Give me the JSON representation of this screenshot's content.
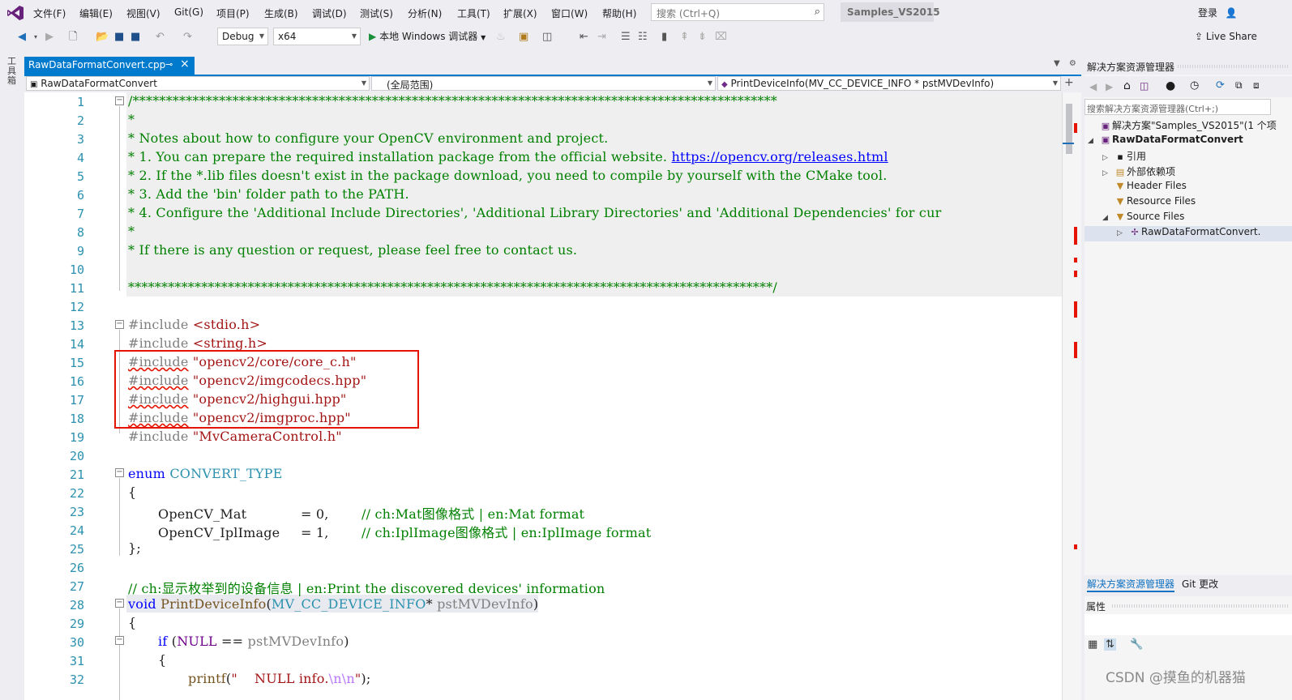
{
  "menu": {
    "items": [
      "文件(F)",
      "编辑(E)",
      "视图(V)",
      "Git(G)",
      "项目(P)",
      "生成(B)",
      "调试(D)",
      "测试(S)",
      "分析(N)",
      "工具(T)",
      "扩展(X)",
      "窗口(W)",
      "帮助(H)"
    ],
    "search_placeholder": "搜索 (Ctrl+Q)",
    "solution_name": "Samples_VS2015",
    "login": "登录"
  },
  "toolbar": {
    "config": "Debug",
    "platform": "x64",
    "run_label": "本地 Windows 调试器",
    "live_share": "Live Share"
  },
  "left_strip": {
    "label": "工具箱"
  },
  "editor": {
    "tab_title": "RawDataFormatConvert.cpp",
    "nav_project": "RawDataFormatConvert",
    "nav_scope": "(全局范围)",
    "nav_member": "PrintDeviceInfo(MV_CC_DEVICE_INFO * pstMVDevInfo)",
    "line_numbers": [
      "1",
      "2",
      "3",
      "4",
      "5",
      "6",
      "7",
      "8",
      "9",
      "10",
      "11",
      "12",
      "13",
      "14",
      "15",
      "16",
      "17",
      "18",
      "19",
      "20",
      "21",
      "22",
      "23",
      "24",
      "25",
      "26",
      "27",
      "28",
      "29",
      "30",
      "31",
      "32"
    ],
    "code": {
      "l1": "/*************************************************************************************************",
      "l2": "*",
      "l3": "* Notes about how to configure your OpenCV environment and project.",
      "l4_pre": "* 1. You can prepare the required installation package from the official website. ",
      "l4_url": "https://opencv.org/releases.html",
      "l5": "* 2. If the *.lib files doesn't exist in the package download, you need to compile by yourself with the CMake tool.",
      "l6": "* 3. Add the 'bin' folder path to the PATH.",
      "l7": "* 4. Configure the 'Additional Include Directories', 'Additional Library Directories' and 'Additional Dependencies' for cur",
      "l8": "*",
      "l9": "* If there is any question or request, please feel free to contact us.",
      "l11": "*************************************************************************************************/",
      "inc_kw": "#include",
      "l13_file": "<stdio.h>",
      "l14_file": "<string.h>",
      "l15_file": "\"opencv2/core/core_c.h\"",
      "l16_file": "\"opencv2/imgcodecs.hpp\"",
      "l17_file": "\"opencv2/highgui.hpp\"",
      "l18_file": "\"opencv2/imgproc.hpp\"",
      "l19_file": "\"MvCameraControl.h\"",
      "l21_kw": "enum",
      "l21_name": "CONVERT_TYPE",
      "l22": "{",
      "l23_name": "OpenCV_Mat",
      "l23_val": "= 0,",
      "l23_cm": "// ch:Mat图像格式 | en:Mat format",
      "l24_name": "OpenCV_IplImage",
      "l24_val": "= 1,",
      "l24_cm": "// ch:IplImage图像格式 | en:IplImage format",
      "l25": "};",
      "l27": "// ch:显示枚举到的设备信息 | en:Print the discovered devices' information",
      "l28_kw": "void",
      "l28_fn": "PrintDeviceInfo",
      "l28_open": "(",
      "l28_type": "MV_CC_DEVICE_INFO",
      "l28_star": "* ",
      "l28_param": "pstMVDevInfo",
      "l28_close": ")",
      "l29": "{",
      "l30_kw": "if",
      "l30_a": " (",
      "l30_null": "NULL",
      "l30_b": " == ",
      "l30_param": "pstMVDevInfo",
      "l30_c": ")",
      "l31": "{",
      "l32_fn": "printf",
      "l32_a": "(",
      "l32_str": "\"    NULL info.",
      "l32_esc": "\\n\\n",
      "l32_end": "\"",
      "l32_close": ");"
    }
  },
  "solution_explorer": {
    "title": "解决方案资源管理器",
    "search_placeholder": "搜索解决方案资源管理器(Ctrl+;)",
    "items": [
      {
        "label": "解决方案\"Samples_VS2015\"(1 个项"
      },
      {
        "label": "RawDataFormatConvert"
      },
      {
        "label": "引用"
      },
      {
        "label": "外部依赖项"
      },
      {
        "label": "Header Files"
      },
      {
        "label": "Resource Files"
      },
      {
        "label": "Source Files"
      },
      {
        "label": "RawDataFormatConvert."
      }
    ],
    "tab_active": "解决方案资源管理器",
    "tab_other": "Git 更改"
  },
  "properties": {
    "title": "属性"
  },
  "watermark": "CSDN @摸鱼的机器猫",
  "colors": {
    "accent": "#007acc",
    "highlight_box": "#e51400",
    "comment": "#008000",
    "keyword": "#0000ff",
    "string": "#a31515"
  }
}
